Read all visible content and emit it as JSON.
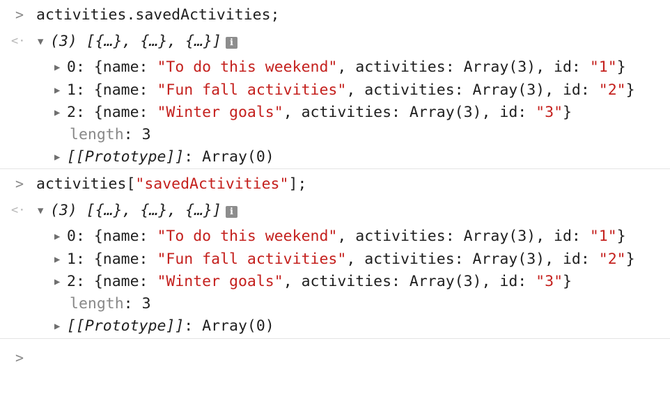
{
  "console": {
    "prompt_symbol": ">",
    "result_symbol": "<·",
    "empty_prompt": ">",
    "info_badge": "i",
    "entries": [
      {
        "command": {
          "plain": "activities.savedActivities;"
        },
        "summary": "(3) [{…}, {…}, {…}]",
        "items": [
          {
            "index": "0",
            "name": "To do this weekend",
            "activities": "Array(3)",
            "id": "1"
          },
          {
            "index": "1",
            "name": "Fun fall activities",
            "activities": "Array(3)",
            "id": "2"
          },
          {
            "index": "2",
            "name": "Winter goals",
            "activities": "Array(3)",
            "id": "3"
          }
        ],
        "length_key": "length",
        "length_value": "3",
        "prototype_key": "[[Prototype]]",
        "prototype_value": "Array(0)"
      },
      {
        "command": {
          "prefix": "activities[",
          "string": "\"savedActivities\"",
          "suffix": "];"
        },
        "summary": "(3) [{…}, {…}, {…}]",
        "items": [
          {
            "index": "0",
            "name": "To do this weekend",
            "activities": "Array(3)",
            "id": "1"
          },
          {
            "index": "1",
            "name": "Fun fall activities",
            "activities": "Array(3)",
            "id": "2"
          },
          {
            "index": "2",
            "name": "Winter goals",
            "activities": "Array(3)",
            "id": "3"
          }
        ],
        "length_key": "length",
        "length_value": "3",
        "prototype_key": "[[Prototype]]",
        "prototype_value": "Array(0)"
      }
    ],
    "colors": {
      "string": "#c4201d",
      "text": "#1f1f1f",
      "muted": "#888888",
      "divider": "#e4e4e4"
    }
  }
}
